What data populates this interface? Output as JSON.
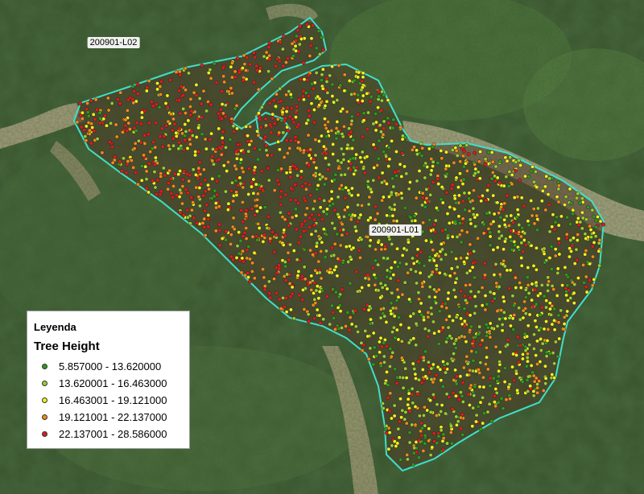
{
  "map": {
    "parcels": [
      {
        "id": "200901-L02"
      },
      {
        "id": "200901-L01"
      }
    ]
  },
  "legend": {
    "title": "Leyenda",
    "heading": "Tree Height",
    "items": [
      {
        "label": "5.857000 - 13.620000",
        "color": "#2e9a1c"
      },
      {
        "label": "13.620001 - 16.463000",
        "color": "#9acd32"
      },
      {
        "label": "16.463001 - 19.121000",
        "color": "#f2f21a"
      },
      {
        "label": "19.121001 - 22.137000",
        "color": "#f08a1a"
      },
      {
        "label": "22.137001 - 28.586000",
        "color": "#d81e1e"
      }
    ]
  },
  "colors": {
    "boundary": "#3fe0c8"
  }
}
